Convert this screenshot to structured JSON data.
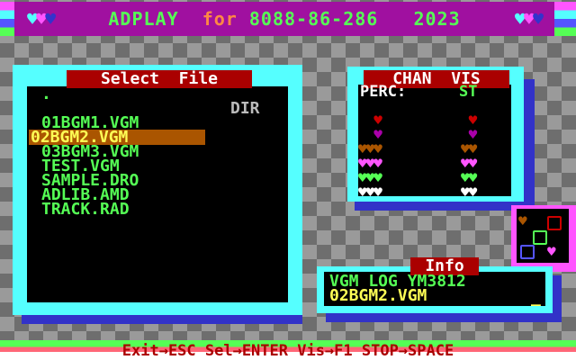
{
  "title_bar": {
    "hearts_left": "♥♥♥",
    "app_name": "ADPLAY",
    "word_for": "for",
    "platforms": "8088-86-286",
    "year": "2023",
    "hearts_right": "♥♥♥"
  },
  "file_panel": {
    "title": "Select  File",
    "dir_label": "DIR",
    "entries": [
      {
        "name": "."
      },
      {
        "name": "01BGM1.VGM"
      },
      {
        "name": "02BGM2.VGM"
      },
      {
        "name": "03BGM3.VGM"
      },
      {
        "name": "TEST.VGM"
      },
      {
        "name": "SAMPLE.DRO"
      },
      {
        "name": "ADLIB.AMD"
      },
      {
        "name": "TRACK.RAD"
      }
    ],
    "selected_index": 2
  },
  "chan_vis": {
    "title": "CHAN  VIS",
    "label_perc": "PERC:",
    "label_st": "ST",
    "rows_left": [
      "  ♥",
      "  ♥",
      "♥♥♥",
      "♥♥♥",
      "♥♥♥",
      "♥♥♥"
    ],
    "rows_right": [
      " ♥",
      " ♥",
      "♥♥",
      "♥♥",
      "♥♥",
      "♥♥"
    ],
    "row_colors": [
      "#cc0000",
      "#aa00aa",
      "#aa5500",
      "#ff55ff",
      "#55ff55",
      "#ffffff"
    ]
  },
  "info_panel": {
    "title": "Info",
    "line1": "VGM LOG YM3812",
    "line2": "02BGM2.VGM",
    "cursor": "_"
  },
  "bottom_bar": {
    "help_text": "Exit→ESC Sel→ENTER Vis→F1 STOP→SPACE"
  },
  "colors": {
    "accent_title_bg": "#a010a0",
    "selection_bg": "#aa5500",
    "list_text": "#55ff55"
  }
}
